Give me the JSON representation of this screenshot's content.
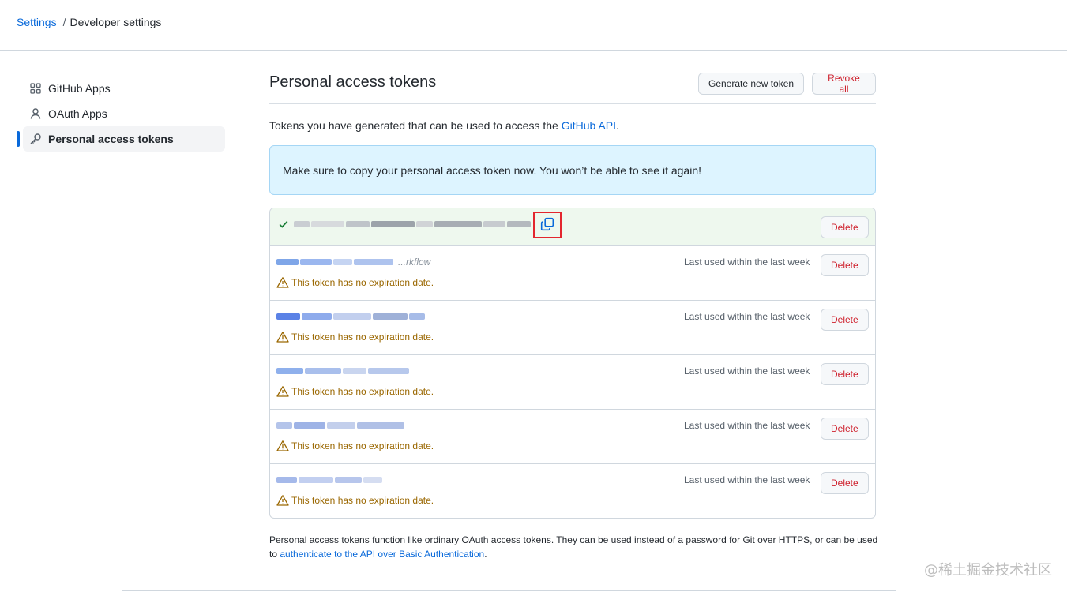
{
  "breadcrumb": {
    "settings_label": "Settings",
    "separator": "/",
    "current_label": "Developer settings"
  },
  "sidebar": {
    "items": [
      {
        "label": "GitHub Apps",
        "icon": "apps-icon"
      },
      {
        "label": "OAuth Apps",
        "icon": "person-icon"
      },
      {
        "label": "Personal access tokens",
        "icon": "key-icon",
        "active": true
      }
    ]
  },
  "header": {
    "title": "Personal access tokens",
    "generate_label": "Generate new token",
    "revoke_label": "Revoke all"
  },
  "intro": {
    "text": "Tokens you have generated that can be used to access the ",
    "link_label": "GitHub API",
    "suffix": "."
  },
  "flash": {
    "message": "Make sure to copy your personal access token now. You won’t be able to see it again!"
  },
  "new_token": {
    "delete_label": "Delete",
    "copy_icon": "copy-icon",
    "check_icon": "check-icon"
  },
  "tokens": [
    {
      "name": "...rkflow",
      "warning": "This token has no expiration date.",
      "last_used": "Last used within the last week",
      "delete_label": "Delete"
    },
    {
      "warning": "This token has no expiration date.",
      "last_used": "Last used within the last week",
      "delete_label": "Delete"
    },
    {
      "warning": "This token has no expiration date.",
      "last_used": "Last used within the last week",
      "delete_label": "Delete"
    },
    {
      "warning": "This token has no expiration date.",
      "last_used": "Last used within the last week",
      "delete_label": "Delete"
    },
    {
      "warning": "This token has no expiration date.",
      "last_used": "Last used within the last week",
      "delete_label": "Delete"
    }
  ],
  "footer": {
    "text": "Personal access tokens function like ordinary OAuth access tokens. They can be used instead of a password for Git over HTTPS, or can be used to ",
    "link_label": "authenticate to the API over Basic Authentication",
    "suffix": "."
  },
  "watermark": "@稀土掘金技术社区",
  "colors": {
    "link": "#0969da",
    "danger": "#cf222e",
    "warning": "#9a6700",
    "flash_bg": "#ddf4ff",
    "success_bg": "#eef8ee",
    "highlight_box": "#e3262e"
  }
}
